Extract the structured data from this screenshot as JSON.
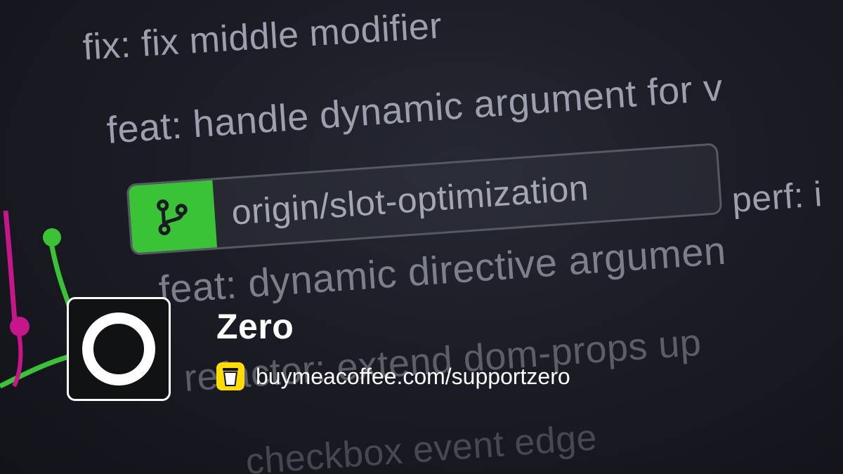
{
  "background_log": {
    "lines": [
      "fix: fix middle modifier",
      "feat: handle dynamic argument for v",
      "perf: i",
      "feat: dynamic directive argumen",
      "refactor: extend dom-props up",
      "checkbox event edge"
    ],
    "branch": {
      "label": "origin/slot-optimization",
      "icon": "git-branch-icon",
      "accent": "#3bc337"
    }
  },
  "profile": {
    "name": "Zero",
    "url": "buymeacoffee.com/supportzero",
    "link_icon": "coffee-cup-icon",
    "avatar_icon": "ring-icon",
    "colors": {
      "coffee": "#ffdd00",
      "text": "#ffffff"
    }
  }
}
